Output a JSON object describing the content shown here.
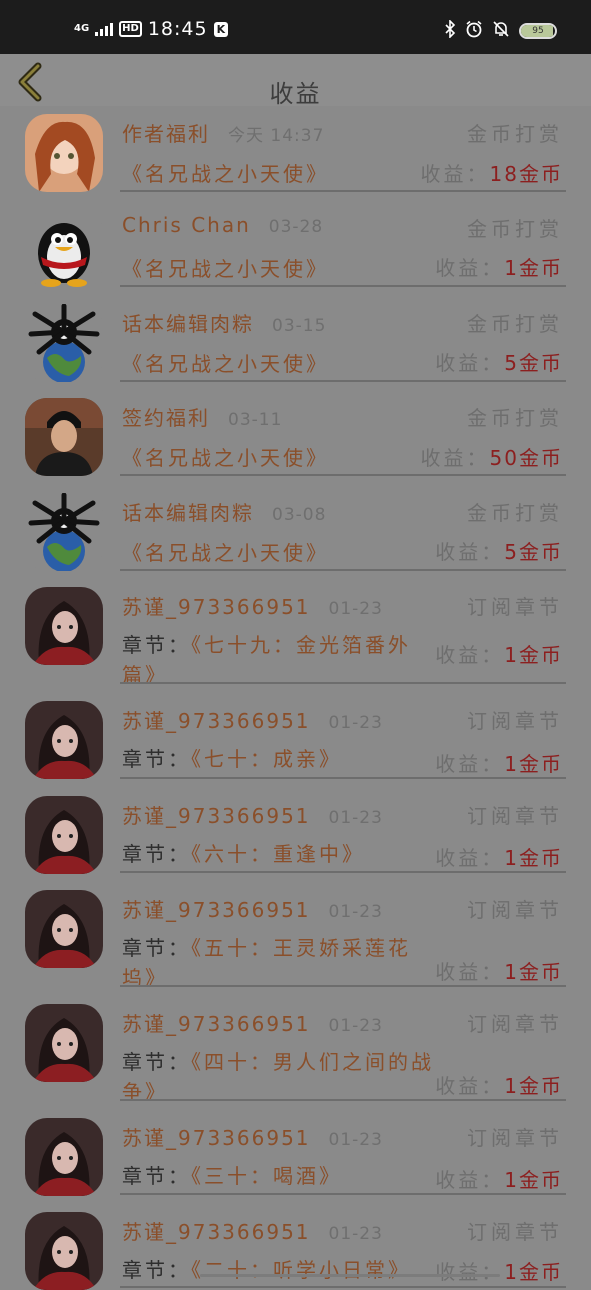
{
  "status_bar": {
    "network": "4G",
    "hd": "HD",
    "time": "18:45",
    "k_badge": "K",
    "battery": "95",
    "battery_level": 0.95
  },
  "header": {
    "title": "收益"
  },
  "colors": {
    "name": "#8a4f2a",
    "amount": "#8c1f1f",
    "overlay_bg": "#8a8a8a"
  },
  "records": [
    {
      "avatar": "anime-girl",
      "name": "作者福利",
      "time": "今天 14:37",
      "type": "金币打赏",
      "work": "《名兄战之小天使》",
      "earn_label": "收益：",
      "amount": "18金币"
    },
    {
      "avatar": "penguin",
      "name": "Chris Chan",
      "time": "03-28",
      "type": "金币打赏",
      "work": "《名兄战之小天使》",
      "earn_label": "收益：",
      "amount": "1金币"
    },
    {
      "avatar": "virus-globe",
      "name": "话本编辑肉粽",
      "time": "03-15",
      "type": "金币打赏",
      "work": "《名兄战之小天使》",
      "earn_label": "收益：",
      "amount": "5金币"
    },
    {
      "avatar": "man-portrait",
      "name": "签约福利",
      "time": "03-11",
      "type": "金币打赏",
      "work": "《名兄战之小天使》",
      "earn_label": "收益：",
      "amount": "50金币"
    },
    {
      "avatar": "virus-globe",
      "name": "话本编辑肉粽",
      "time": "03-08",
      "type": "金币打赏",
      "work": "《名兄战之小天使》",
      "earn_label": "收益：",
      "amount": "5金币"
    },
    {
      "avatar": "girl-red",
      "name": "苏谨_973366951",
      "time": "01-23",
      "type": "订阅章节",
      "chapter_label": "章节：",
      "chapter": "《七十九：金光箔番外篇》",
      "earn_label": "收益：",
      "amount": "1金币"
    },
    {
      "avatar": "girl-red",
      "name": "苏谨_973366951",
      "time": "01-23",
      "type": "订阅章节",
      "chapter_label": "章节：",
      "chapter": "《七十：成亲》",
      "earn_label": "收益：",
      "amount": "1金币"
    },
    {
      "avatar": "girl-red",
      "name": "苏谨_973366951",
      "time": "01-23",
      "type": "订阅章节",
      "chapter_label": "章节：",
      "chapter": "《六十：重逢中》",
      "earn_label": "收益：",
      "amount": "1金币"
    },
    {
      "avatar": "girl-red",
      "name": "苏谨_973366951",
      "time": "01-23",
      "type": "订阅章节",
      "chapter_label": "章节：",
      "chapter": "《五十：王灵娇采莲花坞》",
      "earn_label": "收益：",
      "amount": "1金币"
    },
    {
      "avatar": "girl-red",
      "name": "苏谨_973366951",
      "time": "01-23",
      "type": "订阅章节",
      "chapter_label": "章节：",
      "chapter": "《四十：男人们之间的战争》",
      "earn_label": "收益：",
      "amount": "1金币"
    },
    {
      "avatar": "girl-red",
      "name": "苏谨_973366951",
      "time": "01-23",
      "type": "订阅章节",
      "chapter_label": "章节：",
      "chapter": "《三十：喝酒》",
      "earn_label": "收益：",
      "amount": "1金币"
    },
    {
      "avatar": "girl-red",
      "name": "苏谨_973366951",
      "time": "01-23",
      "type": "订阅章节",
      "chapter_label": "章节：",
      "chapter": "《二十：听学小日常》",
      "earn_label": "收益：",
      "amount": "1金币"
    }
  ]
}
